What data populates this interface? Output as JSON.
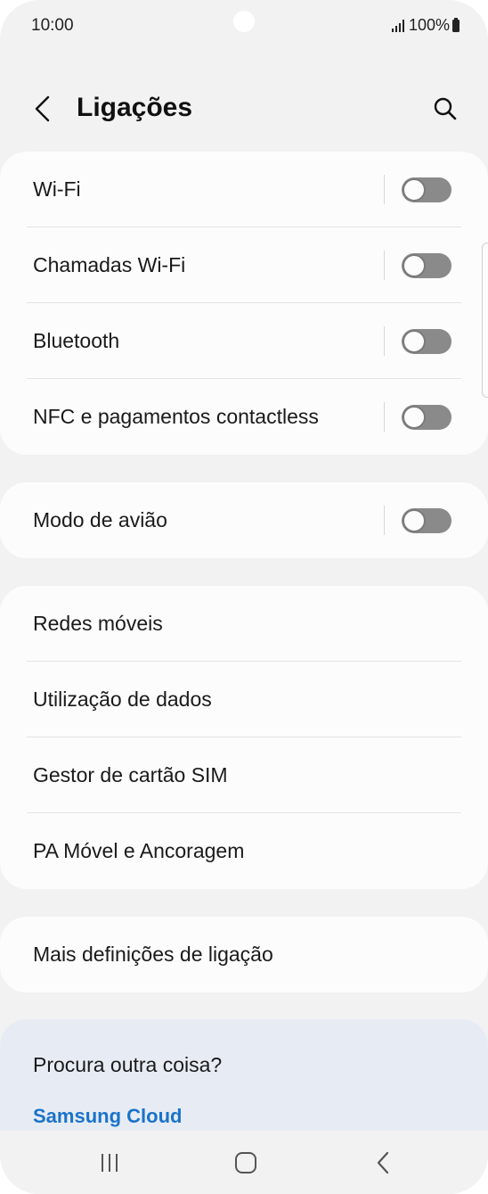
{
  "status_bar": {
    "time": "10:00",
    "battery": "100%"
  },
  "header": {
    "title": "Ligações"
  },
  "card_connections": [
    {
      "label": "Wi-Fi",
      "toggle_on": false
    },
    {
      "label": "Chamadas Wi-Fi",
      "toggle_on": false
    },
    {
      "label": "Bluetooth",
      "toggle_on": false
    },
    {
      "label": "NFC e pagamentos contactless",
      "toggle_on": false
    }
  ],
  "card_airplane": [
    {
      "label": "Modo de avião",
      "toggle_on": false
    }
  ],
  "card_networks": [
    {
      "label": "Redes móveis"
    },
    {
      "label": "Utilização de dados"
    },
    {
      "label": "Gestor de cartão SIM"
    },
    {
      "label": "PA Móvel e Ancoragem"
    }
  ],
  "card_more": [
    {
      "label": "Mais definições de ligação"
    }
  ],
  "help": {
    "title": "Procura outra coisa?",
    "link": "Samsung Cloud"
  },
  "colors": {
    "background": "#f2f2f2",
    "card": "#fcfcfc",
    "toggle_off": "#8a8a8a",
    "link": "#1a73c9",
    "help_bg": "#e7ecf4"
  }
}
